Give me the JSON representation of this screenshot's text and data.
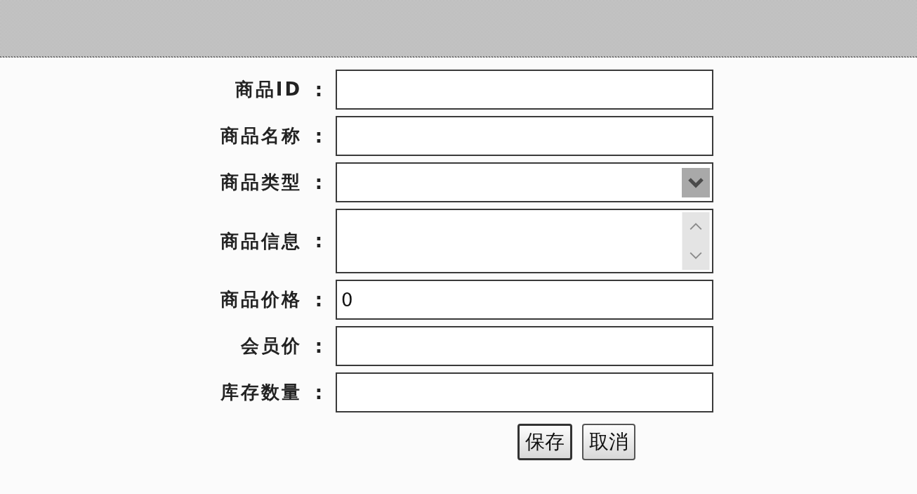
{
  "form": {
    "fields": [
      {
        "label": "商品ID",
        "colon": ":",
        "kind": "text"
      },
      {
        "label": "商品名称",
        "colon": ":",
        "kind": "text"
      },
      {
        "label": "商品类型",
        "colon": ":",
        "kind": "select"
      },
      {
        "label": "商品信息",
        "colon": ":",
        "kind": "textarea"
      },
      {
        "label": "商品价格",
        "colon": ":",
        "kind": "text",
        "value": "0"
      },
      {
        "label": "会员价",
        "colon": ":",
        "kind": "text"
      },
      {
        "label": "库存数量",
        "colon": ":",
        "kind": "text"
      }
    ],
    "buttons": [
      {
        "label": "保存",
        "default": true
      },
      {
        "label": "取消",
        "default": false
      }
    ]
  }
}
